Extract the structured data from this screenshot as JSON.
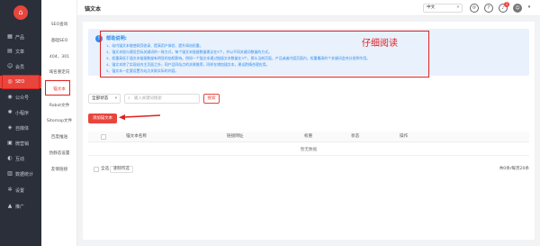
{
  "sidebar": {
    "logo": "⌂",
    "items": [
      {
        "label": "产品",
        "icon": "box-icon",
        "glyph": "▦",
        "active": false
      },
      {
        "label": "文章",
        "icon": "article-icon",
        "glyph": "▤",
        "active": false
      },
      {
        "label": "会员",
        "icon": "user-icon",
        "glyph": "☺",
        "active": false
      },
      {
        "label": "SEO",
        "icon": "seo-icon",
        "glyph": "◎",
        "active": true
      },
      {
        "label": "公众号",
        "icon": "wechat-icon",
        "glyph": "◉",
        "active": false
      },
      {
        "label": "小程序",
        "icon": "miniapp-icon",
        "glyph": "✺",
        "active": false
      },
      {
        "label": "自媒体",
        "icon": "media-icon",
        "glyph": "◈",
        "active": false
      },
      {
        "label": "微营销",
        "icon": "marketing-icon",
        "glyph": "▣",
        "active": false
      },
      {
        "label": "互动",
        "icon": "interact-icon",
        "glyph": "◐",
        "active": false
      },
      {
        "label": "数据统计",
        "icon": "stats-icon",
        "glyph": "▥",
        "active": false
      },
      {
        "label": "设置",
        "icon": "gear-icon",
        "glyph": "✲",
        "active": false
      },
      {
        "label": "推广",
        "icon": "promote-icon",
        "glyph": "▲",
        "active": false
      }
    ]
  },
  "submenu": {
    "items": [
      {
        "label": "SEO查询",
        "active": false
      },
      {
        "label": "基础SEO",
        "active": false
      },
      {
        "label": "404、301",
        "active": false
      },
      {
        "label": "域名重定向",
        "active": false
      },
      {
        "label": "锚文本",
        "active": true
      },
      {
        "label": "Robot文件",
        "active": false
      },
      {
        "label": "Sitemap文件",
        "active": false
      },
      {
        "label": "百度推送",
        "active": false
      },
      {
        "label": "伪静态设置",
        "active": false
      },
      {
        "label": "友情链接",
        "active": false
      }
    ]
  },
  "header": {
    "title": "锚文本",
    "language": "中文",
    "notification_count": "1"
  },
  "help": {
    "title": "帮助说明:",
    "lines": [
      "1、站内锚文本能使网页收录、提高用户体验、提升网站权重。",
      "2、锚文本指与建设目标关键词的一致方式，每个锚文本链接数量建议在5个，并以不同关键词数量的方式。",
      "3、权重高低于锚文本链接数量有明显的加权影响。例如一个锚文本通过链接文本数量在3个，那么当前页面，产品或者内容页面内，权重最高的个关键词会充分发挥作用。",
      "4、锚文本除了实现站内主页面之外，同产品同站点的关联推荐，同样在增加锚文本，建议酌情合理应用。",
      "5、锚文本一定要设置为站点关联实际的内容。"
    ],
    "annotation": "仔细阅读"
  },
  "filters": {
    "status_select": "全部状态",
    "search_placeholder": "输入关键词搜索",
    "search_button": "搜索"
  },
  "toolbar": {
    "add_button": "添加锚文本"
  },
  "table": {
    "columns": [
      "锚文本名称",
      "链接网址",
      "权重",
      "状态",
      "操作"
    ],
    "empty_text": "暂无数据"
  },
  "footer": {
    "select_all": "全选",
    "delete_selected": "删除所选",
    "total": "共0条/每页20条"
  },
  "colors": {
    "accent": "#e8453c",
    "sidebar_bg": "#2b2f3a",
    "help_bg": "#e8f1fc",
    "help_text": "#2d8cf0",
    "annotation_red": "#e02020"
  }
}
